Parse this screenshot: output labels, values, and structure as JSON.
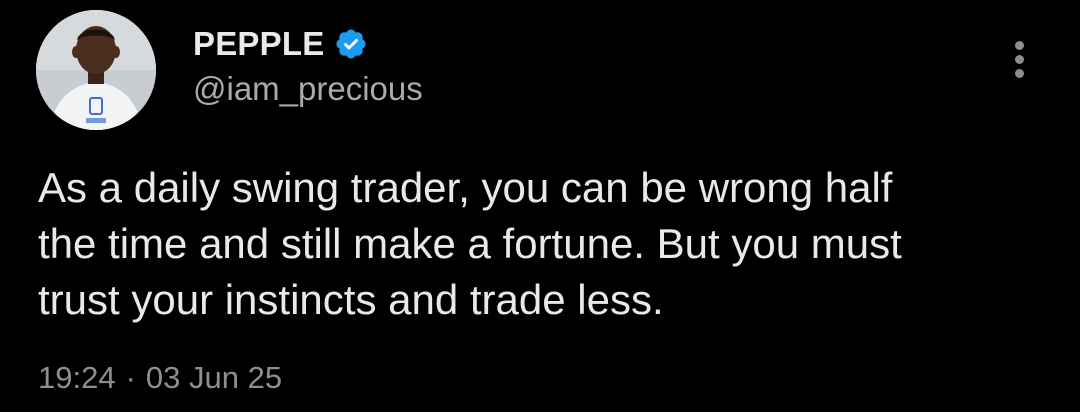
{
  "author": {
    "display_name": "PEPPLE",
    "handle": "@iam_precious",
    "verified": true,
    "verified_color": "#1d9bf0",
    "avatar_icon": "profile-photo"
  },
  "tweet": {
    "text": "As a daily swing trader, you can be wrong half\nthe time and still make a fortune. But you must\ntrust your instincts and trade less.",
    "time": "19:24",
    "separator": "·",
    "date": "03 Jun 25"
  },
  "actions": {
    "more_icon": "more-vertical-icon"
  },
  "colors": {
    "background": "#000000",
    "primary_text": "#e7e9ea",
    "secondary_text": "#8b8f93"
  }
}
